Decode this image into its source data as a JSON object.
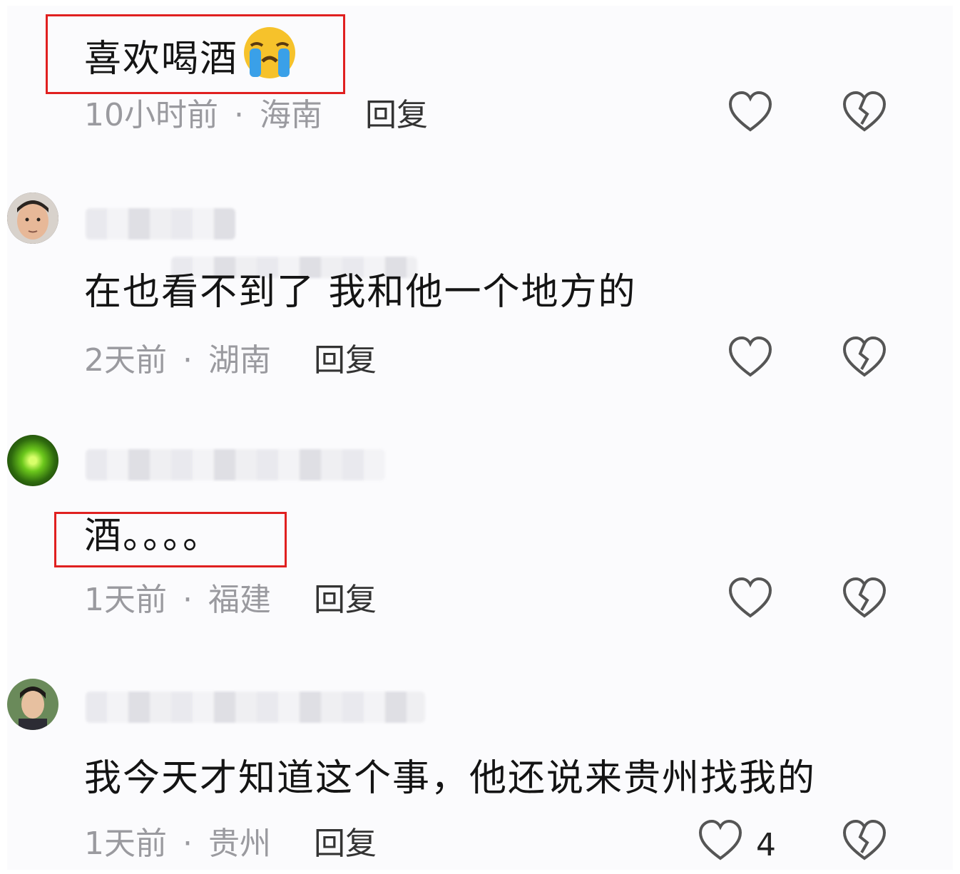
{
  "comments": [
    {
      "text": "喜欢喝酒",
      "emoji": "loudly-crying-face",
      "time": "10小时前",
      "location": "海南",
      "reply_label": "回复",
      "highlighted": true
    },
    {
      "avatar": "avatar-man-1",
      "text": "在也看不到了 我和他一个地方的",
      "time": "2天前",
      "location": "湖南",
      "reply_label": "回复"
    },
    {
      "avatar": "avatar-green-glow",
      "text": "酒。。。。",
      "time": "1天前",
      "location": "福建",
      "reply_label": "回复",
      "highlighted": true
    },
    {
      "avatar": "avatar-man-2",
      "text": "我今天才知道这个事，他还说来贵州找我的",
      "time": "1天前",
      "location": "贵州",
      "reply_label": "回复",
      "likes": "4"
    }
  ],
  "meta_separator": "·",
  "colors": {
    "highlight": "#e02020",
    "meta": "#9a9a9f",
    "text": "#141414"
  }
}
